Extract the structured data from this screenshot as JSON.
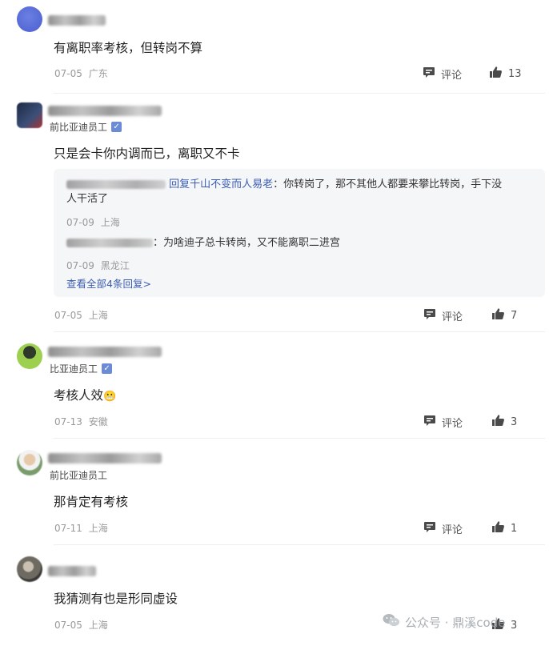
{
  "comments": [
    {
      "badge": "",
      "text": "有离职率考核，但转岗不算",
      "date": "07-05",
      "location": "广东",
      "comment_label": "评论",
      "likes": "13"
    },
    {
      "badge": "前比亚迪员工",
      "text": "只是会卡你内调而已，离职又不卡",
      "replies": [
        {
          "reply_to": "回复千山不变而人易老",
          "text_part1": "：你转岗了，那不其他人都要来攀比转岗，手下没",
          "text_part2": "人干活了",
          "date": "07-09",
          "location": "上海"
        },
        {
          "text": "：为啥迪子总卡转岗，又不能离职二进宫",
          "date": "07-09",
          "location": "黑龙江"
        }
      ],
      "more_replies": "查看全部4条回复>",
      "date": "07-05",
      "location": "上海",
      "comment_label": "评论",
      "likes": "7"
    },
    {
      "badge": "比亚迪员工",
      "text": "考核人效",
      "date": "07-13",
      "location": "安徽",
      "comment_label": "评论",
      "likes": "3"
    },
    {
      "badge": "前比亚迪员工",
      "text": "那肯定有考核",
      "date": "07-11",
      "location": "上海",
      "comment_label": "评论",
      "likes": "1"
    },
    {
      "badge": "",
      "text": "我猜测有也是形同虚设",
      "date": "07-05",
      "location": "上海",
      "comment_label": "评论",
      "likes": "3"
    }
  ],
  "watermark": "公众号 · 鼎溪code",
  "icons": {
    "comment": "comment-icon",
    "like": "thumbs-up-icon",
    "verified": "verified-badge-icon",
    "wechat": "wechat-icon"
  },
  "colors": {
    "link": "#3b5cb0",
    "meta": "#999999",
    "reply_bg": "#f5f6f8"
  }
}
